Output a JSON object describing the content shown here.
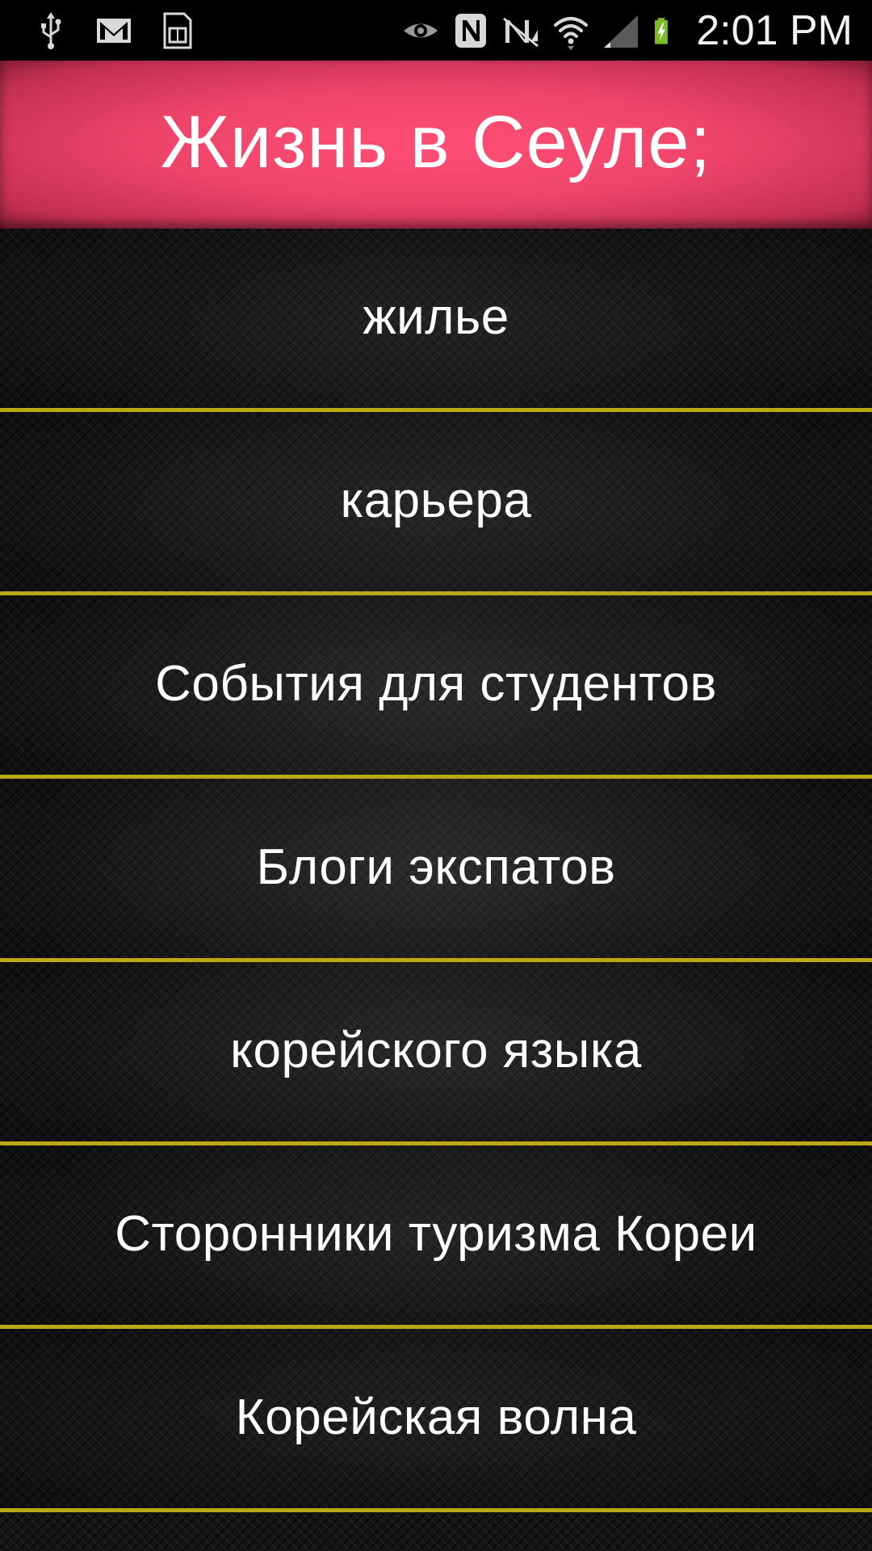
{
  "status_bar": {
    "time": "2:01 PM",
    "icons_left": [
      "usb-icon",
      "gmail-icon",
      "sim-card-icon"
    ],
    "icons_right": [
      "eye-icon",
      "nfc-icon",
      "no-signal-icon",
      "wifi-icon",
      "signal-icon",
      "battery-charging-icon"
    ]
  },
  "header": {
    "title": "Жизнь в Сеуле;",
    "color": "#ff4e75"
  },
  "menu": {
    "divider_color": "#b9a916",
    "items": [
      {
        "label": "жилье"
      },
      {
        "label": "карьера"
      },
      {
        "label": "События для студентов"
      },
      {
        "label": "Блоги экспатов"
      },
      {
        "label": "корейского языка"
      },
      {
        "label": "Сторонники туризма Кореи"
      },
      {
        "label": "Корейская волна"
      }
    ]
  }
}
